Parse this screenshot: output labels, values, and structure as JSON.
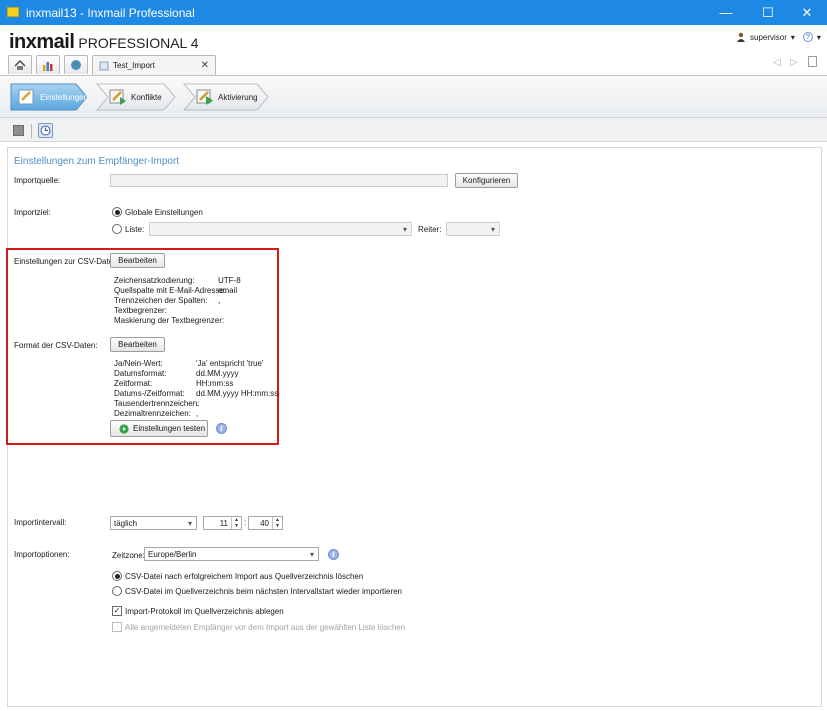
{
  "window": {
    "title": "inxmail13 - Inxmail Professional",
    "minimize": "—",
    "maximize": "☐",
    "close": "✕"
  },
  "app": {
    "logo_bold": "inxmail",
    "logo_product": "PROFESSIONAL 4",
    "user": "supervisor",
    "help": "?"
  },
  "tabs": {
    "active_tab": "Test_Import",
    "close": "✕"
  },
  "wizard": {
    "steps": [
      {
        "label": "Einstellungen"
      },
      {
        "label": "Konflikte"
      },
      {
        "label": "Aktivierung"
      }
    ]
  },
  "form": {
    "section_title": "Einstellungen zum Empfänger-Import",
    "import_source": {
      "label": "Importquelle:",
      "value": "",
      "button": "Konfigurieren"
    },
    "import_target": {
      "label": "Importziel:",
      "option_global": "Globale Einstellungen",
      "option_list": "Liste:",
      "list_value": "",
      "reiter_label": "Reiter:",
      "reiter_value": ""
    },
    "csv_file": {
      "label": "Einstellungen zur CSV-Datei:",
      "button": "Bearbeiten",
      "rows": [
        {
          "key": "Zeichensatzkodierung:",
          "value": "UTF-8"
        },
        {
          "key": "Quellspalte mit E-Mail-Adresse:",
          "value": "email"
        },
        {
          "key": "Trennzeichen der Spalten:",
          "value": ","
        },
        {
          "key": "Textbegrenzer:",
          "value": ""
        },
        {
          "key": "Maskierung der Textbegrenzer:",
          "value": ""
        }
      ]
    },
    "csv_format": {
      "label": "Format der CSV-Daten:",
      "button": "Bearbeiten",
      "rows": [
        {
          "key": "Ja/Nein-Wert:",
          "value": "'Ja' entspricht 'true'"
        },
        {
          "key": "Datumsformat:",
          "value": "dd.MM.yyyy"
        },
        {
          "key": "Zeitformat:",
          "value": "HH:mm:ss"
        },
        {
          "key": "Datums-/Zeitformat:",
          "value": "dd.MM.yyyy HH:mm:ss"
        },
        {
          "key": "Tausendertrennzeichen:",
          "value": "."
        },
        {
          "key": "Dezimaltrennzeichen:",
          "value": ","
        }
      ],
      "test_button": "Einstellungen testen"
    },
    "interval": {
      "label": "Importintervall:",
      "value": "täglich",
      "hour": "11",
      "separator": ":",
      "minute": "40"
    },
    "options": {
      "label": "Importoptionen:",
      "timezone_label": "Zeitzone:",
      "timezone_value": "Europe/Berlin",
      "radio_delete": "CSV-Datei nach erfolgreichem Import aus Quellverzeichnis löschen",
      "radio_reimport": "CSV-Datei im Quellverzeichnis beim nächsten Intervallstart wieder importieren",
      "check_protocol": "Import-Protokoll im Quellverzeichnis ablegen",
      "check_delete_all": "Alle angemeldeten Empfänger vor dem Import aus der gewählten Liste löschen"
    }
  }
}
